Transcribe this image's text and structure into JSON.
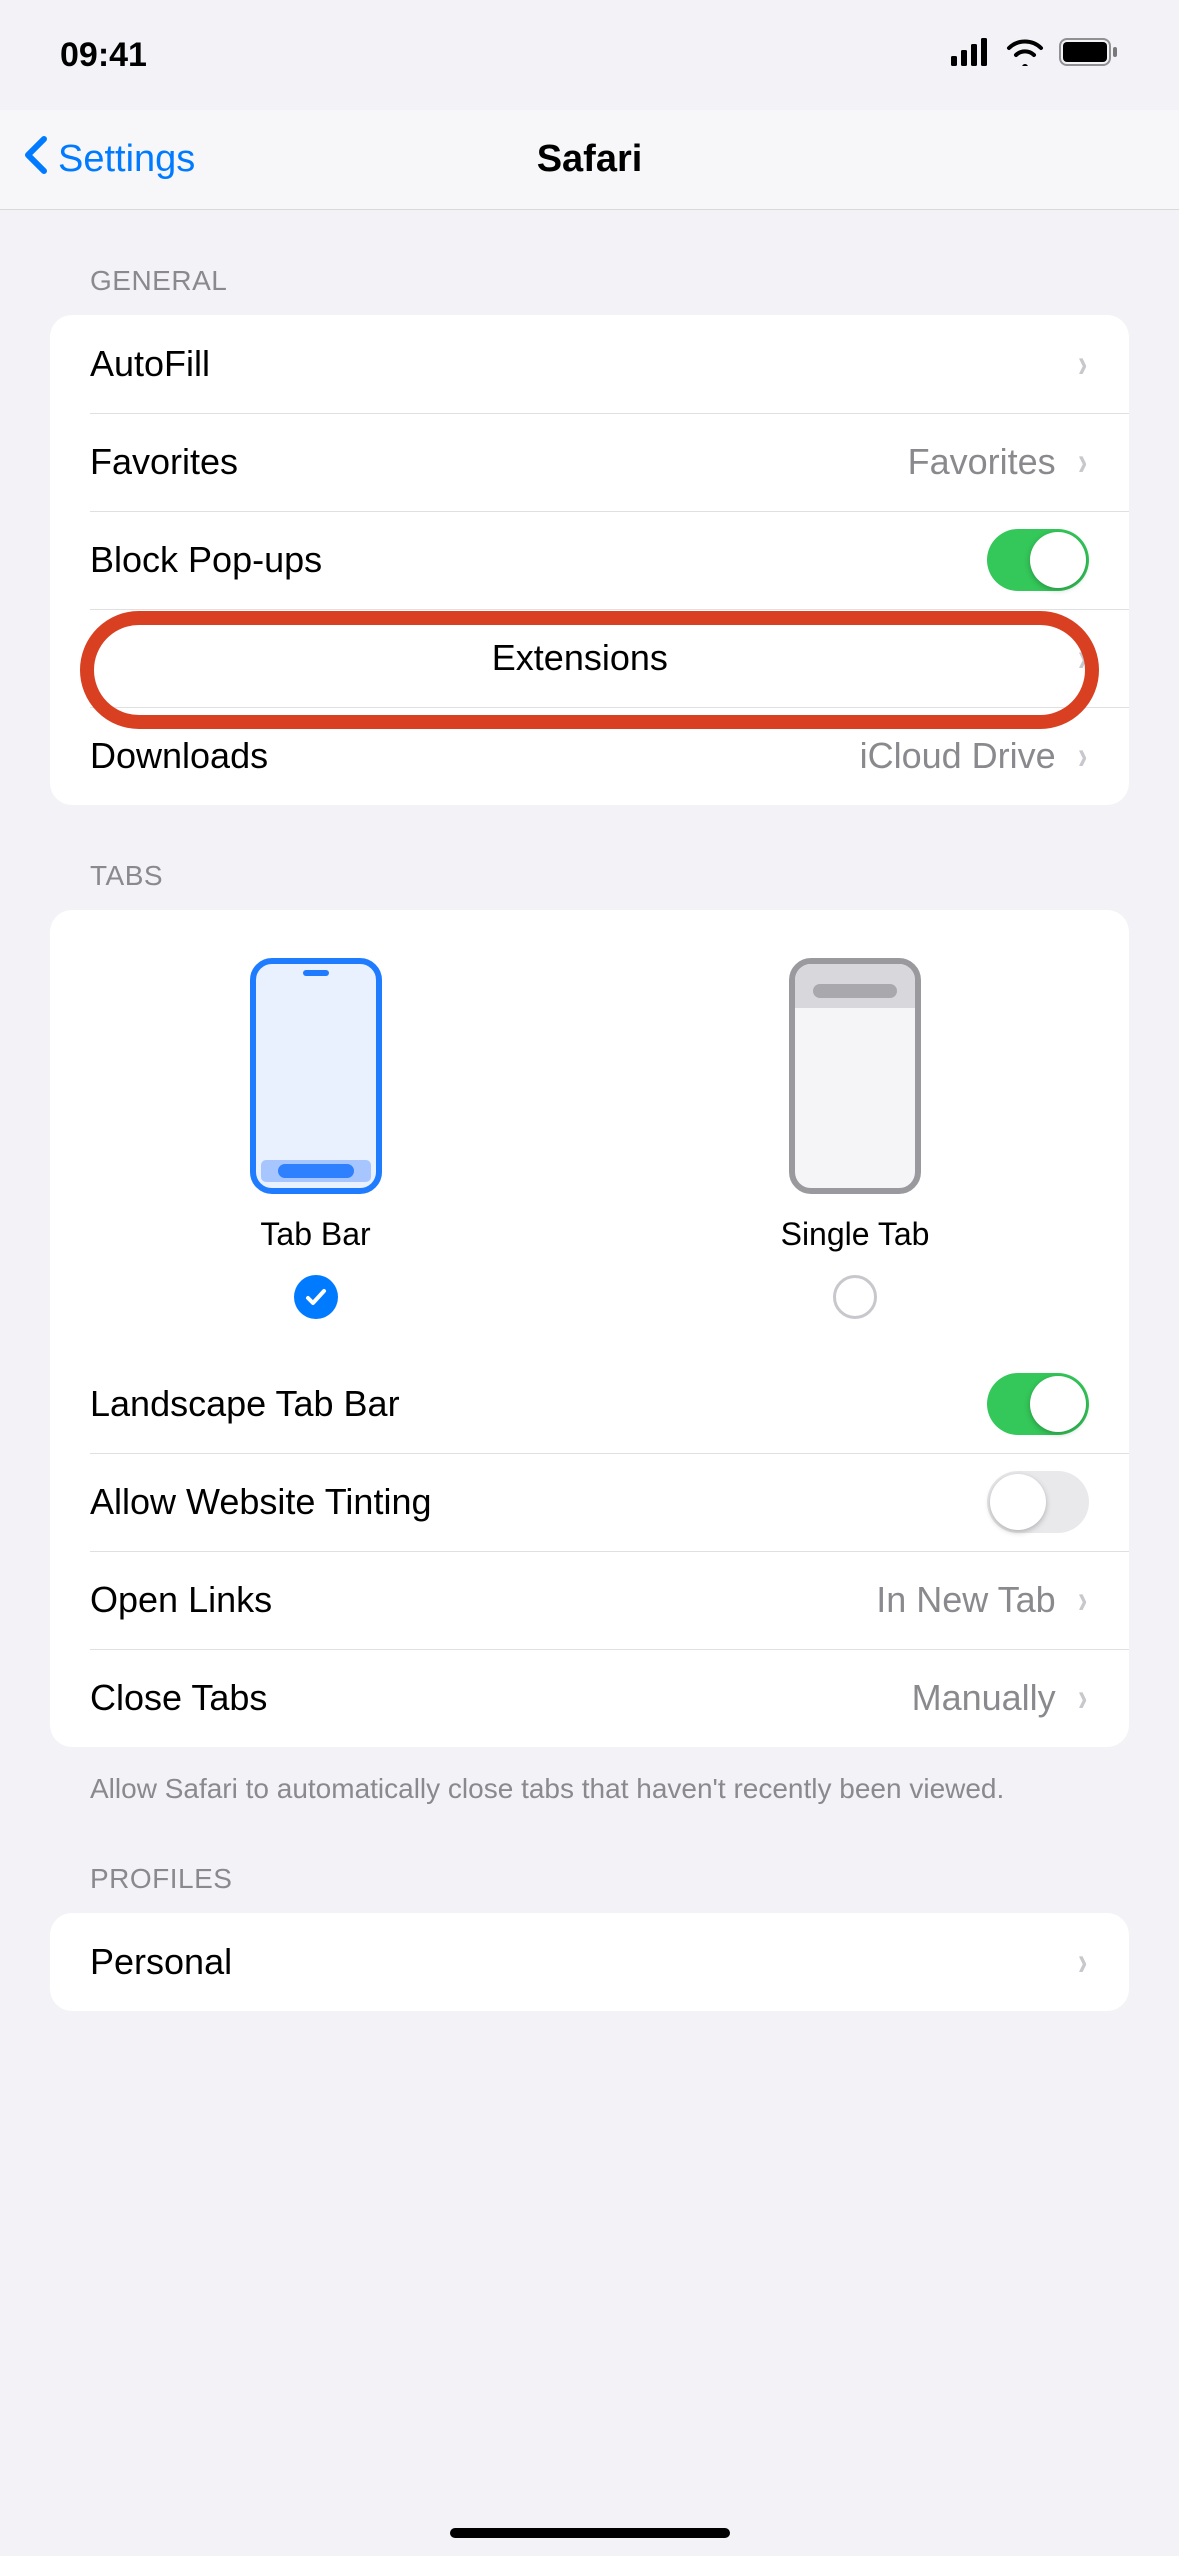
{
  "status": {
    "time": "09:41"
  },
  "nav": {
    "back": "Settings",
    "title": "Safari"
  },
  "sections": {
    "general": {
      "header": "GENERAL",
      "autofill": "AutoFill",
      "favorites_label": "Favorites",
      "favorites_value": "Favorites",
      "block_popups": "Block Pop-ups",
      "block_popups_on": true,
      "extensions": "Extensions",
      "downloads_label": "Downloads",
      "downloads_value": "iCloud Drive"
    },
    "tabs": {
      "header": "TABS",
      "option_tab_bar": "Tab Bar",
      "option_single_tab": "Single Tab",
      "selected": "tab_bar",
      "landscape": "Landscape Tab Bar",
      "landscape_on": true,
      "tinting": "Allow Website Tinting",
      "tinting_on": false,
      "open_links_label": "Open Links",
      "open_links_value": "In New Tab",
      "close_tabs_label": "Close Tabs",
      "close_tabs_value": "Manually",
      "footer": "Allow Safari to automatically close tabs that haven't recently been viewed."
    },
    "profiles": {
      "header": "PROFILES",
      "personal": "Personal"
    }
  }
}
